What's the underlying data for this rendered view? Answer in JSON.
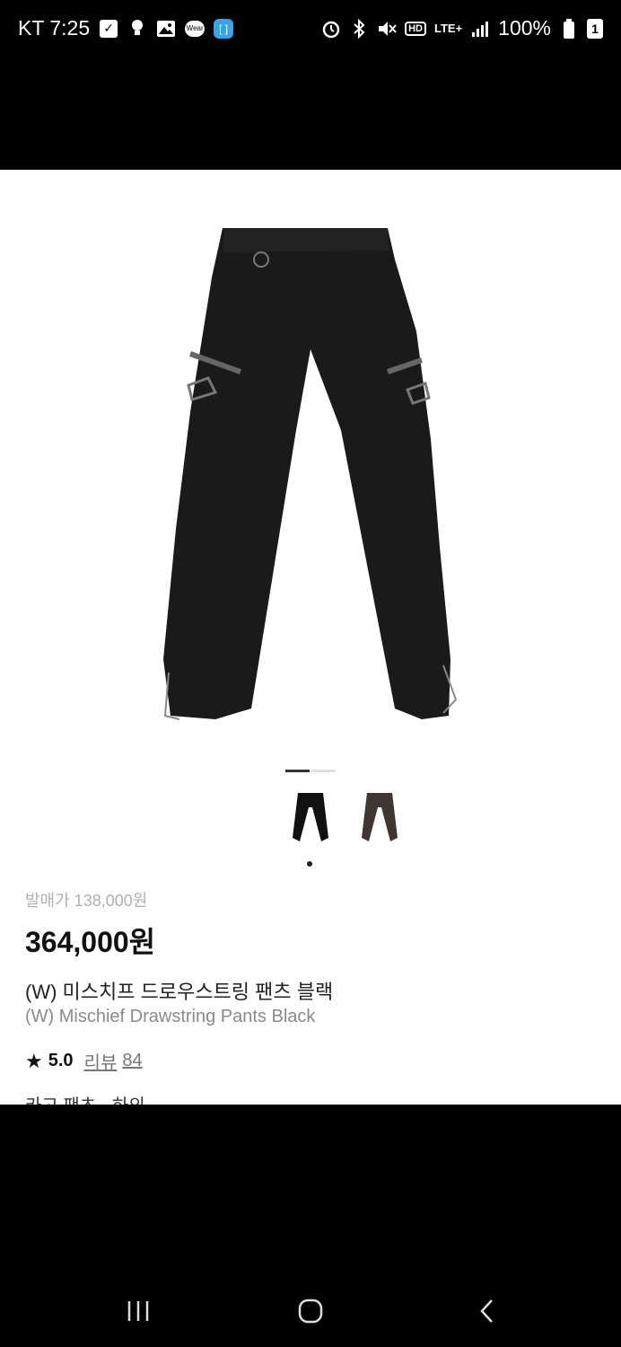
{
  "status_bar": {
    "carrier_time": "KT 7:25",
    "battery": "100%",
    "lte": "LTE+",
    "hd": "HD",
    "notification_icons": [
      "check-icon",
      "bulb-icon",
      "gallery-icon",
      "wear-icon",
      "app-icon"
    ],
    "wear_label": "Wear",
    "right_icons": [
      "alarm-icon",
      "bluetooth-icon",
      "mute-icon",
      "hd-icon",
      "lte-icon",
      "signal-icon",
      "battery-icon"
    ],
    "battery_badge": "1"
  },
  "product": {
    "carousel": {
      "total": 2,
      "active": 0
    },
    "variants": [
      {
        "name": "black",
        "color": "#1a1a1a"
      },
      {
        "name": "brown",
        "color": "#3f3532"
      }
    ],
    "selected_variant": 0,
    "release_price": "발매가 138,000원",
    "price": "364,000원",
    "title_ko": "(W) 미스치프 드로우스트링 팬츠 블랙",
    "title_en": "(W) Mischief Drawstring Pants Black",
    "rating": "5.0",
    "review_label": "리뷰",
    "review_count": "84",
    "category": "카고 팬츠 · 하의"
  },
  "nav": {
    "buttons": [
      "recents-icon",
      "home-icon",
      "back-icon"
    ]
  }
}
